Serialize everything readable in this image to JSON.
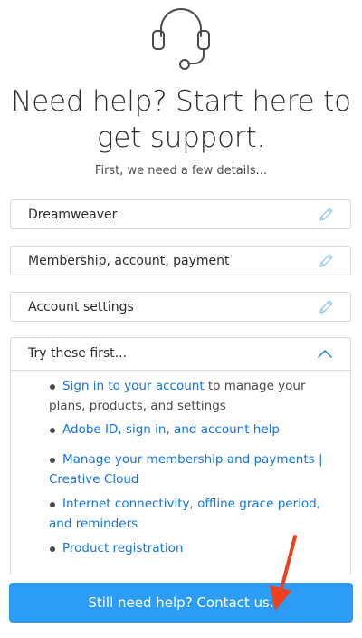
{
  "header": {
    "icon": "headset-icon",
    "title_line1": "Need help? Start here to",
    "title_line2": "get support.",
    "subtitle": "First, we need a few details..."
  },
  "fields": [
    {
      "label": "Dreamweaver",
      "icon": "pencil-icon"
    },
    {
      "label": "Membership, account, payment",
      "icon": "pencil-icon"
    },
    {
      "label": "Account settings",
      "icon": "pencil-icon"
    }
  ],
  "panel": {
    "title": "Try these first...",
    "icon": "chevron-up-icon",
    "items": [
      {
        "link": "Sign in to your account",
        "rest": " to manage your plans, products, and settings"
      },
      {
        "link": "Adobe ID, sign in, and account help",
        "rest": ""
      },
      {
        "link": "Manage your membership and payments | Creative Cloud",
        "rest": ""
      },
      {
        "link": "Internet connectivity, offline grace period, and reminders",
        "rest": ""
      },
      {
        "link": "Product registration",
        "rest": ""
      }
    ]
  },
  "contact_button": {
    "label": "Still need help? Contact us."
  },
  "annotation": {
    "icon": "red-arrow-icon",
    "color": "#f0401c"
  },
  "colors": {
    "accent": "#2d9cf5",
    "link": "#1473e6",
    "border": "#d9d9d9"
  }
}
